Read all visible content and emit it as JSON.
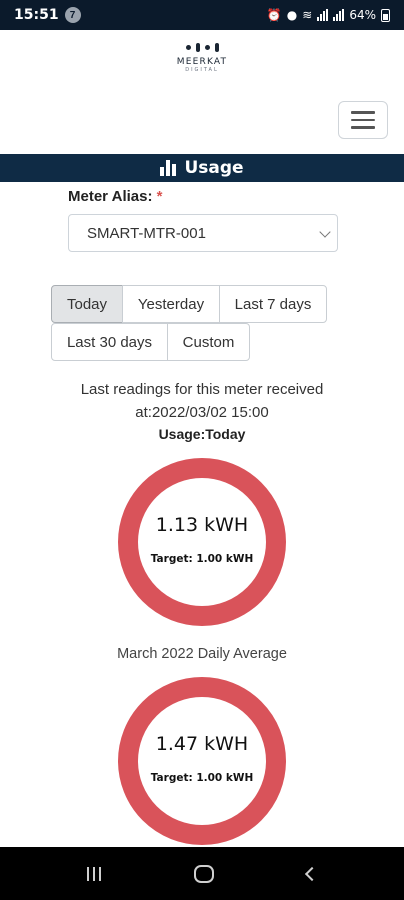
{
  "status_bar": {
    "time": "15:51",
    "notification_count": "7",
    "battery": "64%"
  },
  "brand": {
    "name": "MEERKAT",
    "tagline": "DIGITAL"
  },
  "page": {
    "title": "Usage"
  },
  "meter": {
    "label": "Meter Alias:",
    "required_marker": "*",
    "selected": "SMART-MTR-001"
  },
  "periods": {
    "today": "Today",
    "yesterday": "Yesterday",
    "last7": "Last 7 days",
    "last30": "Last 30 days",
    "custom": "Custom",
    "active": "Today"
  },
  "readings": {
    "line1": "Last readings for this meter received",
    "line2": "at:2022/03/02 15:00"
  },
  "usage": {
    "title": "Usage:Today",
    "value": "1.13 kWH",
    "target": "Target: 1.00 kWH"
  },
  "average": {
    "title": "March 2022 Daily Average",
    "value": "1.47 kWH",
    "target": "Target: 1.00 kWH"
  },
  "colors": {
    "header_bar": "#0f2b45",
    "gauge_ring": "#d9535a",
    "required": "#d9534f"
  }
}
